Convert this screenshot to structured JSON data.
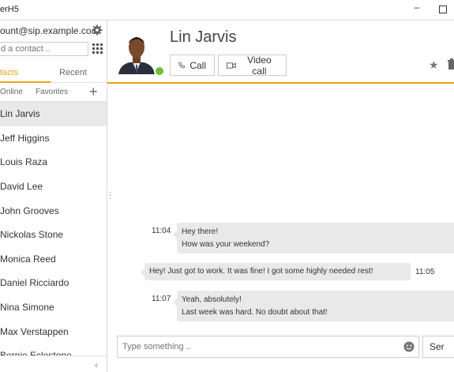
{
  "window": {
    "title": "erH5",
    "minimize_glyph": "–"
  },
  "sidebar": {
    "account": "ount@sip.example.com",
    "search_placeholder": "d a contact ..",
    "tabs": [
      {
        "label": "tacts",
        "active": true
      },
      {
        "label": "Recent",
        "active": false
      }
    ],
    "filters": [
      {
        "label": "Online"
      },
      {
        "label": "Favorites"
      }
    ],
    "add_glyph": "+",
    "contacts": [
      {
        "name": "Lin Jarvis",
        "selected": true
      },
      {
        "name": "Jeff Higgins"
      },
      {
        "name": "Louis Raza"
      },
      {
        "name": "David Lee"
      },
      {
        "name": "John Grooves"
      },
      {
        "name": "Nickolas Stone"
      },
      {
        "name": "Monica Reed"
      },
      {
        "name": "Daniel Ricciardo"
      },
      {
        "name": "Nina Simone"
      },
      {
        "name": "Max Verstappen"
      },
      {
        "name": "Bernie Eclestone"
      }
    ],
    "collapse_glyph": "‹"
  },
  "header": {
    "peer_name": "Lin Jarvis",
    "call_label": "Call",
    "video_label": "Video call",
    "star_glyph": "★"
  },
  "messages": [
    {
      "time": "11:04",
      "lines": [
        "Hey there!",
        "How was your weekend?"
      ]
    },
    {
      "time": "11:05",
      "lines": [
        "Hey! Just got to work. It was fine! I got some highly needed rest!"
      ]
    },
    {
      "time": "11:07",
      "lines": [
        "Yeah, absolutely!",
        "Last week was hard. No doubt about that!"
      ]
    }
  ],
  "composer": {
    "placeholder": "Type something ..",
    "send_label": "Ser"
  },
  "colors": {
    "accent": "#e8a317",
    "presence": "#6bbf3a",
    "bubble": "#e9e9e9"
  }
}
